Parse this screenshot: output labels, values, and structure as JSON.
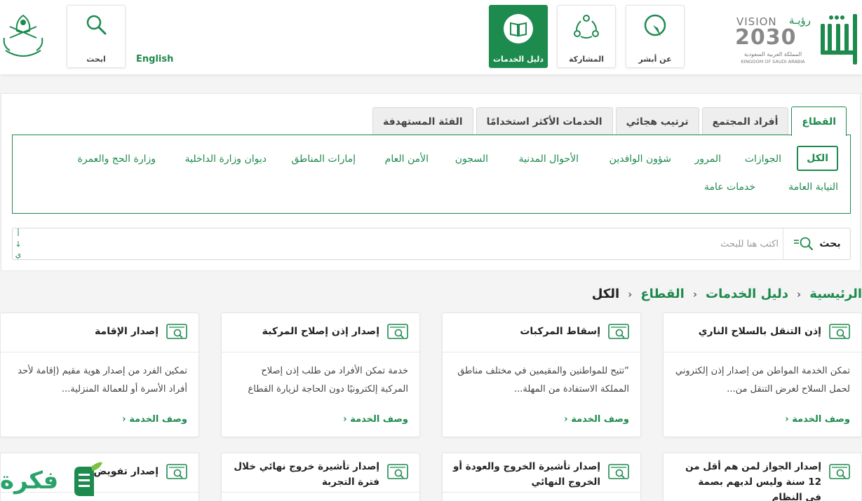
{
  "header": {
    "language_link": "English",
    "buttons": {
      "search": "ابحث",
      "services_guide": "دليل الخدمات",
      "participation": "المشاركة",
      "about": "عن أبشر"
    },
    "vision": {
      "title": "VISION",
      "arabic": "رؤيـة",
      "year": "2030",
      "kingdom_ar": "المملكة العربية السعودية",
      "kingdom_en": "KINGDOM OF SAUDI ARABIA"
    }
  },
  "filters": {
    "tabs": [
      "القطاع",
      "أفراد المجتمع",
      "ترتيب هجائي",
      "الخدمات الأكثر استخدامًا",
      "الفئة المستهدفة"
    ],
    "sectors": [
      "الكل",
      "الجوازات",
      "المرور",
      "شؤون الوافدين",
      "الأحوال المدنية",
      "السجون",
      "الأمن العام",
      "إمارات المناطق",
      "ديوان وزارة الداخلية",
      "وزارة الحج والعمرة",
      "النيابة العامة",
      "خدمات عامة"
    ],
    "sort_key": [
      "أ",
      "↓",
      "ي"
    ]
  },
  "search": {
    "button_label": "بحث",
    "placeholder": "اكتب هنا للبحث"
  },
  "breadcrumb": [
    "الرئيسية",
    "دليل الخدمات",
    "القطاع",
    "الكل"
  ],
  "cards": [
    {
      "title": "إذن التنقل بالسلاح الناري",
      "desc": "تمكن الخدمة المواطن من إصدار إذن إلكتروني لحمل السلاح لغرض التنقل من...",
      "link": "وصف الخدمة"
    },
    {
      "title": "إسقاط المركبات",
      "desc": "“تتيح للمواطنين والمقيمين في مختلف مناطق المملكة الاستفادة من المهلة...",
      "link": "وصف الخدمة"
    },
    {
      "title": "إصدار إذن إصلاح المركبة",
      "desc": "خدمة تمكن الأفراد من طلب إذن إصلاح المركبة إلكترونيًا دون الحاجة لزيارة القطاع",
      "link": "وصف الخدمة"
    },
    {
      "title": "إصدار الإقامة",
      "desc": "تمكين الفرد من إصدار هوية مقيم (إقامة لأحد أفراد الأسرة أو للعمالة المنزلية...",
      "link": "وصف الخدمة"
    },
    {
      "title": "إصدار الجواز لمن هم أقل من 12 سنة وليس لديهم بصمة في النظام"
    },
    {
      "title": "إصدار تأشيرة الخروج والعودة أو الخروج النهائي"
    },
    {
      "title": "إصدار تأشيرة خروج نهائي خلال فترة التجربة"
    },
    {
      "title": "إصدار تفويض"
    }
  ],
  "watermark": "فكرة"
}
